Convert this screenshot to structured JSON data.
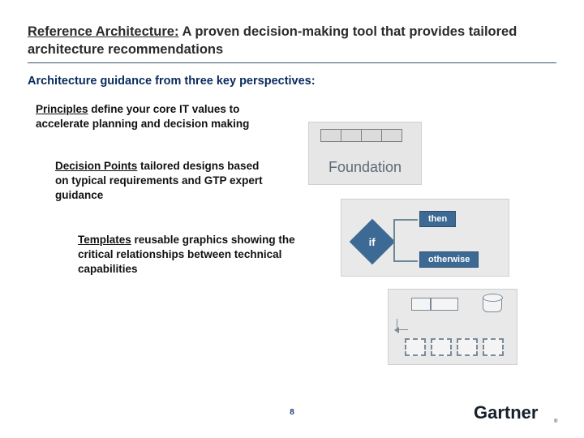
{
  "title_a": "Reference Architecture:",
  "title_b": " A proven decision-making tool that provides tailored architecture recommendations",
  "subtitle": "Architecture guidance from three key perspectives:",
  "principles_u": "Principles",
  "principles_t": " define your core IT values to accelerate planning and decision making",
  "decision_u": "Decision Points",
  "decision_t": " tailored designs based on typical requirements and GTP expert guidance",
  "templates_u": "Templates",
  "templates_t": " reusable graphics showing the critical relationships between technical capabilities",
  "g_foundation": "Foundation",
  "g_if": "if",
  "g_then": "then",
  "g_otherwise": "otherwise",
  "page": "8",
  "brand": "Gartner"
}
